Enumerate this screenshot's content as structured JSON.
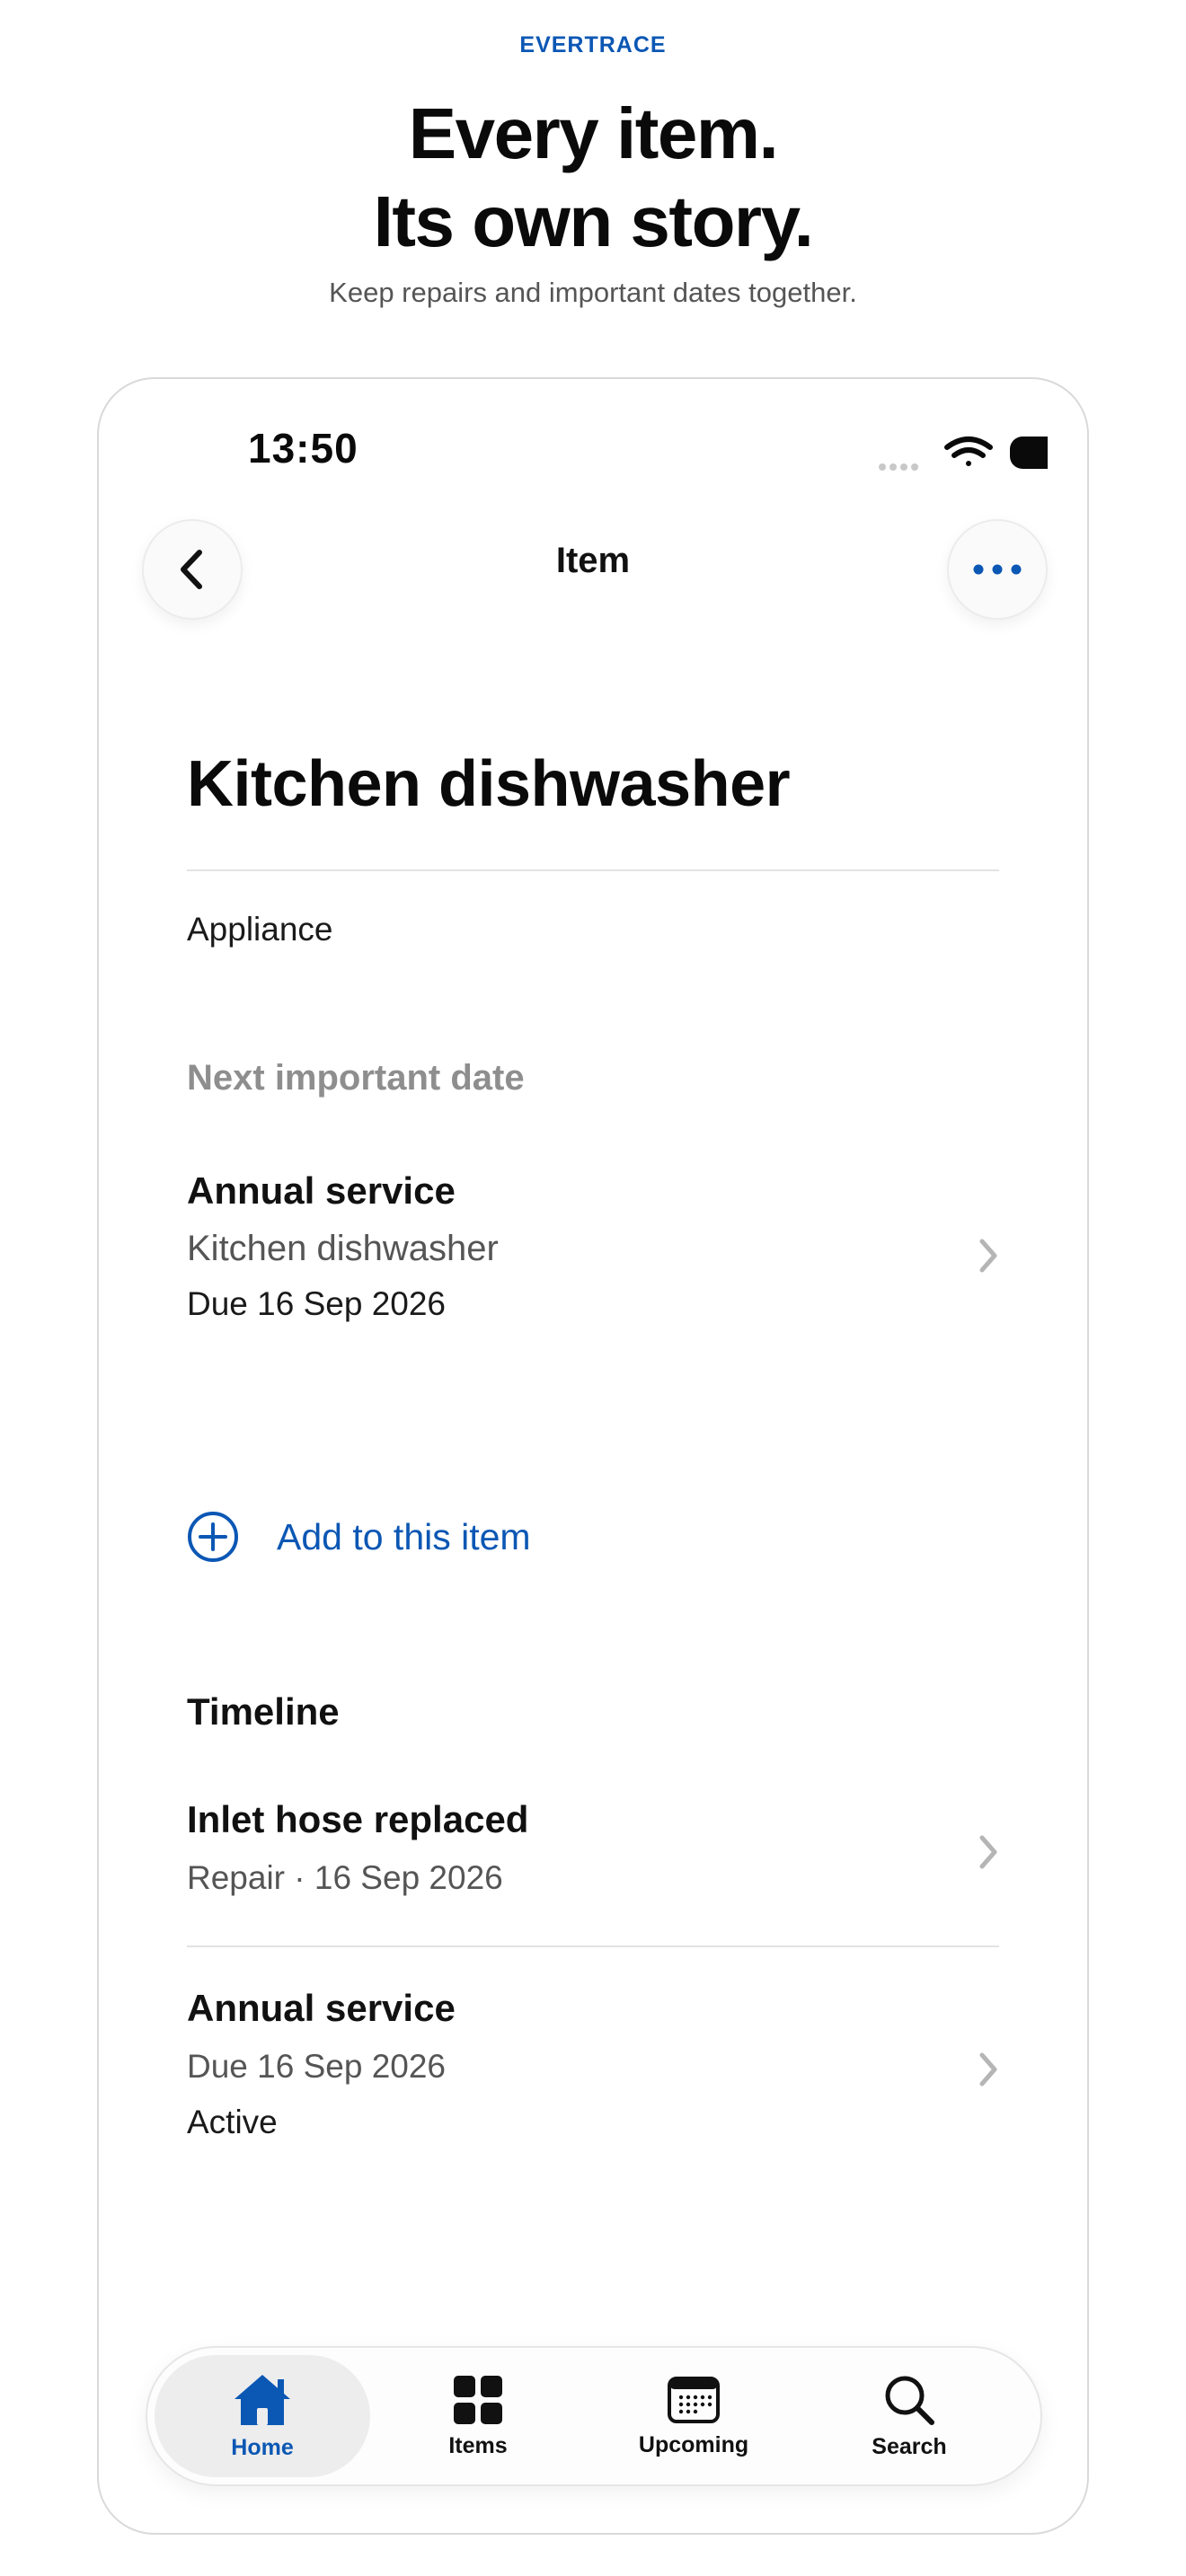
{
  "hero": {
    "brand": "EVERTRACE",
    "headline_line1": "Every item.",
    "headline_line2": "Its own story.",
    "subhead": "Keep repairs and important dates together."
  },
  "status_bar": {
    "time": "13:50"
  },
  "nav": {
    "title": "Item"
  },
  "item": {
    "name": "Kitchen dishwasher",
    "category": "Appliance"
  },
  "next_date": {
    "heading": "Next important date",
    "title": "Annual service",
    "item_name": "Kitchen dishwasher",
    "due": "Due 16 Sep 2026"
  },
  "add_action": {
    "label": "Add to this item"
  },
  "timeline": {
    "heading": "Timeline",
    "entries": [
      {
        "title": "Inlet hose replaced",
        "subtitle": "Repair · 16 Sep 2026"
      },
      {
        "title": "Annual service",
        "subtitle": "Due 16 Sep 2026",
        "status": "Active"
      }
    ]
  },
  "tabbar": {
    "tabs": [
      {
        "label": "Home",
        "icon": "house-icon",
        "active": true
      },
      {
        "label": "Items",
        "icon": "grid-icon",
        "active": false
      },
      {
        "label": "Upcoming",
        "icon": "calendar-icon",
        "active": false
      },
      {
        "label": "Search",
        "icon": "search-icon",
        "active": false
      }
    ]
  },
  "colors": {
    "accent": "#0b57b4",
    "muted": "#8e8e8e",
    "chevron": "#b5b5b5"
  }
}
